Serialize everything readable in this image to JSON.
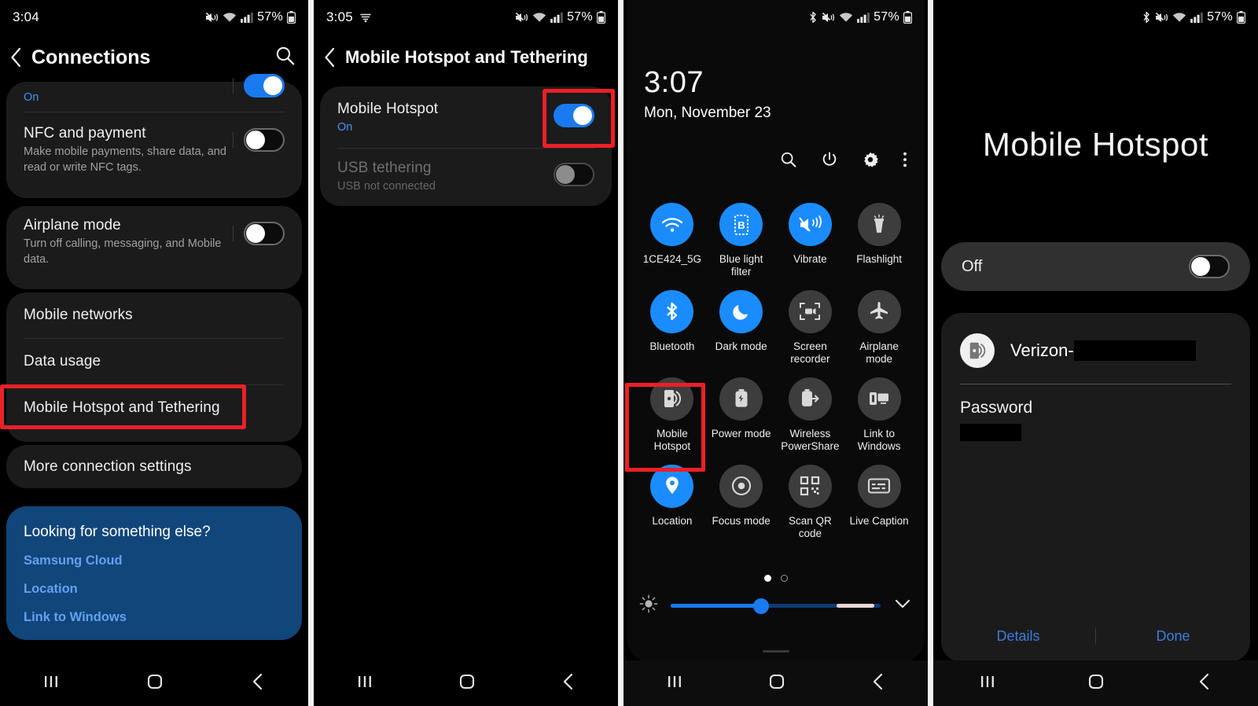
{
  "panels": [
    {
      "id": "connections-settings",
      "status": {
        "time": "3:04",
        "battery": "57%",
        "icons": [
          "mute-icon",
          "wifi-icon",
          "signal-icon",
          "battery-icon"
        ]
      },
      "appbar": {
        "title": "Connections",
        "back": "back-arrow-icon",
        "search": "search-icon"
      },
      "partial_row": {
        "sub": "On"
      },
      "rows": [
        {
          "title": "NFC and payment",
          "sub": "Make mobile payments, share data, and read or write NFC tags.",
          "toggle": "off"
        },
        {
          "title": "Airplane mode",
          "sub": "Turn off calling, messaging, and Mobile data.",
          "toggle": "off"
        },
        {
          "title": "Mobile networks"
        },
        {
          "title": "Data usage"
        },
        {
          "title": "Mobile Hotspot and Tethering",
          "highlighted": true
        },
        {
          "title": "More connection settings"
        }
      ],
      "promo": {
        "heading": "Looking for something else?",
        "links": [
          "Samsung Cloud",
          "Location",
          "Link to Windows"
        ]
      },
      "nav": [
        "recents-icon",
        "home-icon",
        "back-icon"
      ]
    },
    {
      "id": "hotspot-tethering-settings",
      "status": {
        "time": "3:05",
        "battery": "57%",
        "icons": [
          "cast-icon",
          "mute-icon",
          "wifi-icon",
          "signal-icon",
          "battery-icon"
        ]
      },
      "appbar": {
        "title": "Mobile Hotspot and Tethering",
        "back": "back-arrow-icon"
      },
      "rows": [
        {
          "title": "Mobile Hotspot",
          "sub": "On",
          "sub_blue": true,
          "toggle": "on",
          "highlighted_toggle": true
        },
        {
          "title": "USB tethering",
          "sub": "USB not connected",
          "toggle": "disabled",
          "dimmed": true
        }
      ],
      "nav": [
        "recents-icon",
        "home-icon",
        "back-icon"
      ]
    },
    {
      "id": "quick-settings-panel",
      "status": {
        "battery": "57%",
        "icons": [
          "bluetooth-icon",
          "mute-icon",
          "wifi-icon",
          "signal-icon",
          "battery-icon"
        ]
      },
      "clock": "3:07",
      "date": "Mon, November 23",
      "actions": [
        "search-icon",
        "power-icon",
        "gear-icon",
        "more-icon"
      ],
      "tiles": [
        {
          "label": "1CE424_5G",
          "icon": "wifi-icon",
          "active": true
        },
        {
          "label": "Blue light filter",
          "icon": "blue-light-filter-icon",
          "active": true
        },
        {
          "label": "Vibrate",
          "icon": "vibrate-icon",
          "active": true
        },
        {
          "label": "Flashlight",
          "icon": "flashlight-icon",
          "active": false
        },
        {
          "label": "Bluetooth",
          "icon": "bluetooth-icon",
          "active": true
        },
        {
          "label": "Dark mode",
          "icon": "moon-icon",
          "active": true
        },
        {
          "label": "Screen recorder",
          "icon": "screen-recorder-icon",
          "active": false
        },
        {
          "label": "Airplane mode",
          "icon": "airplane-icon",
          "active": false
        },
        {
          "label": "Mobile Hotspot",
          "icon": "mobile-hotspot-icon",
          "active": false,
          "highlighted": true
        },
        {
          "label": "Power mode",
          "icon": "power-mode-icon",
          "active": false
        },
        {
          "label": "Wireless PowerShare",
          "icon": "wireless-powershare-icon",
          "active": false
        },
        {
          "label": "Link to Windows",
          "icon": "link-to-windows-icon",
          "active": false
        },
        {
          "label": "Location",
          "icon": "location-pin-icon",
          "active": true
        },
        {
          "label": "Focus mode",
          "icon": "focus-mode-icon",
          "active": false
        },
        {
          "label": "Scan QR code",
          "icon": "qr-code-icon",
          "active": false
        },
        {
          "label": "Live Caption",
          "icon": "live-caption-icon",
          "active": false
        }
      ],
      "page_dots": {
        "count": 2,
        "current": 1
      },
      "brightness": {
        "icon": "brightness-icon",
        "value_pct": 43,
        "expand": "chevron-down-icon"
      },
      "nav": [
        "recents-icon",
        "home-icon",
        "back-icon"
      ]
    },
    {
      "id": "mobile-hotspot-dialog",
      "status": {
        "battery": "57%",
        "icons": [
          "bluetooth-icon",
          "mute-icon",
          "wifi-icon",
          "signal-icon",
          "battery-icon"
        ]
      },
      "title": "Mobile Hotspot",
      "toggle_card": {
        "label": "Off",
        "toggle": "off"
      },
      "ssid": {
        "icon": "mobile-hotspot-icon",
        "prefix": "Verizon-",
        "redacted": true
      },
      "password": {
        "label": "Password",
        "redacted": true
      },
      "buttons": [
        "Details",
        "Done"
      ],
      "nav": [
        "recents-icon",
        "home-icon",
        "back-icon"
      ]
    }
  ]
}
